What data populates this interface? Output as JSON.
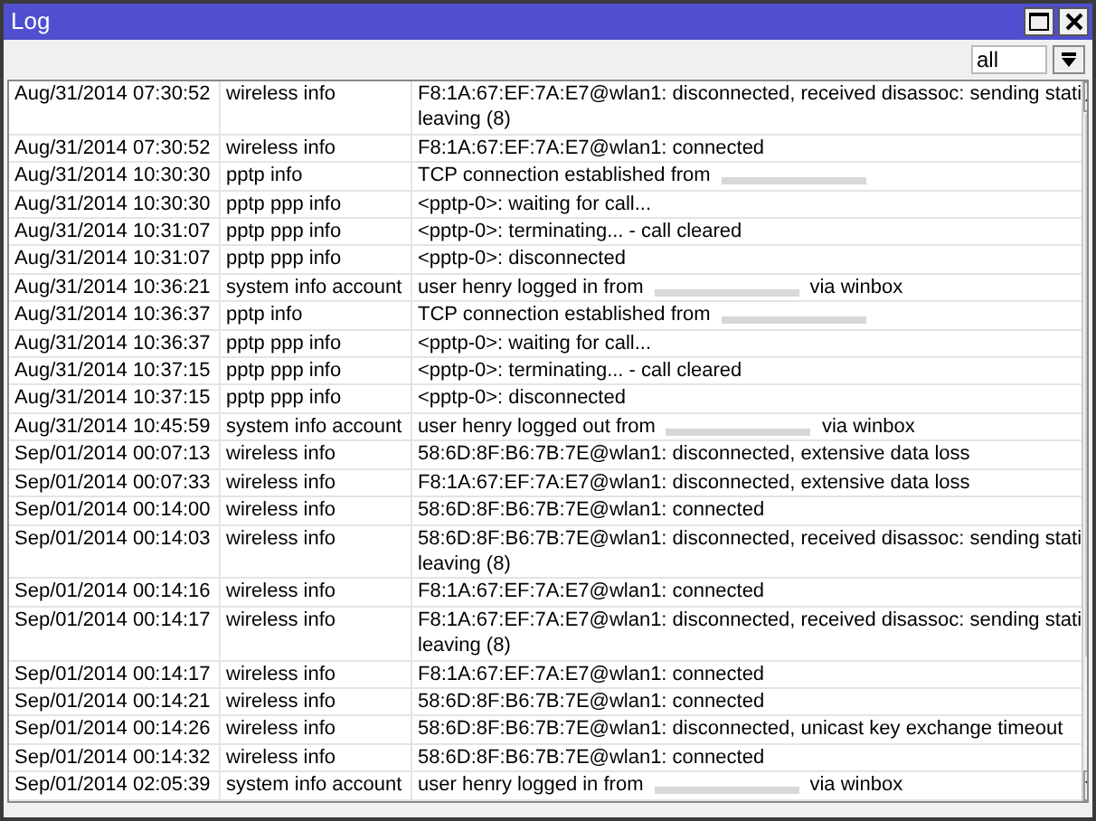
{
  "window": {
    "title": "Log"
  },
  "filter": {
    "value": "all"
  },
  "rows": [
    {
      "time": "Aug/31/2014 07:30:52",
      "topics": "wireless info",
      "lines": [
        "F8:1A:67:EF:7A:E7@wlan1: disconnected, received disassoc: sending stati",
        "leaving (8)"
      ]
    },
    {
      "time": "Aug/31/2014 07:30:52",
      "topics": "wireless info",
      "lines": [
        "F8:1A:67:EF:7A:E7@wlan1: connected"
      ]
    },
    {
      "time": "Aug/31/2014 10:30:30",
      "topics": "pptp info",
      "lines": [
        "TCP connection established from"
      ],
      "redacted": true
    },
    {
      "time": "Aug/31/2014 10:30:30",
      "topics": "pptp ppp info",
      "lines": [
        "<pptp-0>: waiting for call..."
      ]
    },
    {
      "time": "Aug/31/2014 10:31:07",
      "topics": "pptp ppp info",
      "lines": [
        "<pptp-0>: terminating... - call cleared"
      ]
    },
    {
      "time": "Aug/31/2014 10:31:07",
      "topics": "pptp ppp info",
      "lines": [
        "<pptp-0>: disconnected"
      ]
    },
    {
      "time": "Aug/31/2014 10:36:21",
      "topics": "system info account",
      "lines": [
        "user henry logged in from"
      ],
      "redacted": true,
      "after": "via winbox"
    },
    {
      "time": "Aug/31/2014 10:36:37",
      "topics": "pptp info",
      "lines": [
        "TCP connection established from"
      ],
      "redacted": true
    },
    {
      "time": "Aug/31/2014 10:36:37",
      "topics": "pptp ppp info",
      "lines": [
        "<pptp-0>: waiting for call..."
      ]
    },
    {
      "time": "Aug/31/2014 10:37:15",
      "topics": "pptp ppp info",
      "lines": [
        "<pptp-0>: terminating... - call cleared"
      ]
    },
    {
      "time": "Aug/31/2014 10:37:15",
      "topics": "pptp ppp info",
      "lines": [
        "<pptp-0>: disconnected"
      ]
    },
    {
      "time": "Aug/31/2014 10:45:59",
      "topics": "system info account",
      "lines": [
        "user henry logged out from"
      ],
      "redacted": true,
      "after": "via winbox"
    },
    {
      "time": "Sep/01/2014 00:07:13",
      "topics": "wireless info",
      "lines": [
        "58:6D:8F:B6:7B:7E@wlan1: disconnected, extensive data loss"
      ]
    },
    {
      "time": "Sep/01/2014 00:07:33",
      "topics": "wireless info",
      "lines": [
        "F8:1A:67:EF:7A:E7@wlan1: disconnected, extensive data loss"
      ]
    },
    {
      "time": "Sep/01/2014 00:14:00",
      "topics": "wireless info",
      "lines": [
        "58:6D:8F:B6:7B:7E@wlan1: connected"
      ]
    },
    {
      "time": "Sep/01/2014 00:14:03",
      "topics": "wireless info",
      "lines": [
        "58:6D:8F:B6:7B:7E@wlan1: disconnected, received disassoc: sending stati",
        "leaving (8)"
      ]
    },
    {
      "time": "Sep/01/2014 00:14:16",
      "topics": "wireless info",
      "lines": [
        "F8:1A:67:EF:7A:E7@wlan1: connected"
      ]
    },
    {
      "time": "Sep/01/2014 00:14:17",
      "topics": "wireless info",
      "lines": [
        "F8:1A:67:EF:7A:E7@wlan1: disconnected, received disassoc: sending stati",
        "leaving (8)"
      ]
    },
    {
      "time": "Sep/01/2014 00:14:17",
      "topics": "wireless info",
      "lines": [
        "F8:1A:67:EF:7A:E7@wlan1: connected"
      ]
    },
    {
      "time": "Sep/01/2014 00:14:21",
      "topics": "wireless info",
      "lines": [
        "58:6D:8F:B6:7B:7E@wlan1: connected"
      ]
    },
    {
      "time": "Sep/01/2014 00:14:26",
      "topics": "wireless info",
      "lines": [
        "58:6D:8F:B6:7B:7E@wlan1: disconnected, unicast key exchange timeout"
      ]
    },
    {
      "time": "Sep/01/2014 00:14:32",
      "topics": "wireless info",
      "lines": [
        "58:6D:8F:B6:7B:7E@wlan1: connected"
      ]
    },
    {
      "time": "Sep/01/2014 02:05:39",
      "topics": "system info account",
      "lines": [
        "user henry logged in from"
      ],
      "redacted": true,
      "after": "via winbox"
    }
  ]
}
